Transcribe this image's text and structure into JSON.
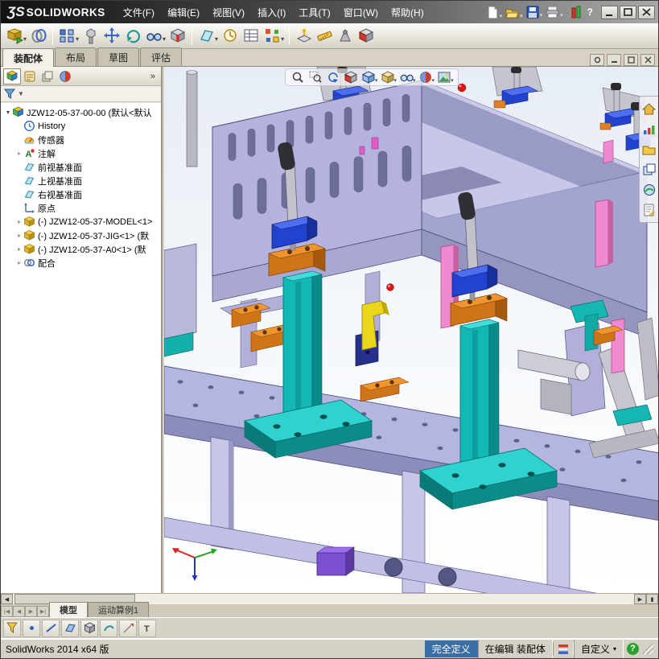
{
  "titlebar": {
    "logo": "ƷS",
    "brand": "SOLIDWORKS",
    "menus": [
      "文件(F)",
      "编辑(E)",
      "视图(V)",
      "插入(I)",
      "工具(T)",
      "窗口(W)",
      "帮助(H)"
    ],
    "quick_icons": [
      "new-document-icon",
      "open-icon",
      "save-icon",
      "print-icon",
      "performance-icon",
      "help-icon"
    ],
    "window_controls": [
      "minimize",
      "maximize",
      "close"
    ]
  },
  "toolbar": {
    "icons": [
      "insert-components",
      "mate",
      "linear-component-pattern",
      "smart-fasteners",
      "move-component",
      "rotate-component",
      "show-hidden-components",
      "assembly-features",
      "reference-geometry",
      "new-motion-study",
      "bill-of-materials",
      "exploded-view",
      "instant3d",
      "measure",
      "mass-properties",
      "section-view"
    ]
  },
  "command_tabs": {
    "items": [
      "装配体",
      "布局",
      "草图",
      "评估"
    ],
    "active": "装配体"
  },
  "feature_panel": {
    "header_icons": [
      "featuremanager-tree",
      "property-manager",
      "configuration-manager",
      "display-manager"
    ],
    "chevron": "»",
    "root": {
      "label": "JZW12-05-37-00-00 (默认<默认"
    },
    "items": [
      {
        "label": "History",
        "icon": "history-icon"
      },
      {
        "label": "传感器",
        "icon": "sensors-icon"
      },
      {
        "label": "注解",
        "icon": "annotations-icon"
      },
      {
        "label": "前视基准面",
        "icon": "plane-icon"
      },
      {
        "label": "上视基准面",
        "icon": "plane-icon"
      },
      {
        "label": "右视基准面",
        "icon": "plane-icon"
      },
      {
        "label": "原点",
        "icon": "origin-icon"
      },
      {
        "label": "(-) JZW12-05-37-MODEL<1>",
        "icon": "component-icon"
      },
      {
        "label": "(-) JZW12-05-37-JIG<1> (默",
        "icon": "component-icon"
      },
      {
        "label": "(-) JZW12-05-37-A0<1> (默",
        "icon": "component-icon"
      },
      {
        "label": "配合",
        "icon": "mates-icon"
      }
    ]
  },
  "viewport": {
    "headsup_icons": [
      "zoom-to-fit",
      "zoom-to-area",
      "previous-view",
      "section-view",
      "view-orientation",
      "display-style",
      "hide-show-items",
      "edit-appearance",
      "apply-scene"
    ],
    "taskpane_icons": [
      "solidworks-resources",
      "design-library",
      "file-explorer",
      "view-palette",
      "appearances-scenes",
      "custom-properties"
    ],
    "model_colors": {
      "plate": "#b5b5e2",
      "box": "#b3b3dd",
      "stand": "#13b7b5",
      "clampblock": "#d0741a",
      "clamp": "#2143cf",
      "pin": "#f08ad0",
      "part_yellow": "#ecd51d"
    }
  },
  "bottom": {
    "doc_tabs": [
      "模型",
      "运动算例1"
    ],
    "active_tab": "模型",
    "filter_icons": [
      "filter-toggle",
      "filter-vertices",
      "filter-edges",
      "filter-faces",
      "filter-solid-bodies",
      "filter-surface-bodies",
      "filter-sketch-segments",
      "filter-annotations"
    ]
  },
  "statusbar": {
    "app": "SolidWorks 2014 x64 版",
    "define_state": "完全定义",
    "edit_state": "在编辑 装配体",
    "custom": "自定义",
    "custom_caret": "▾"
  }
}
